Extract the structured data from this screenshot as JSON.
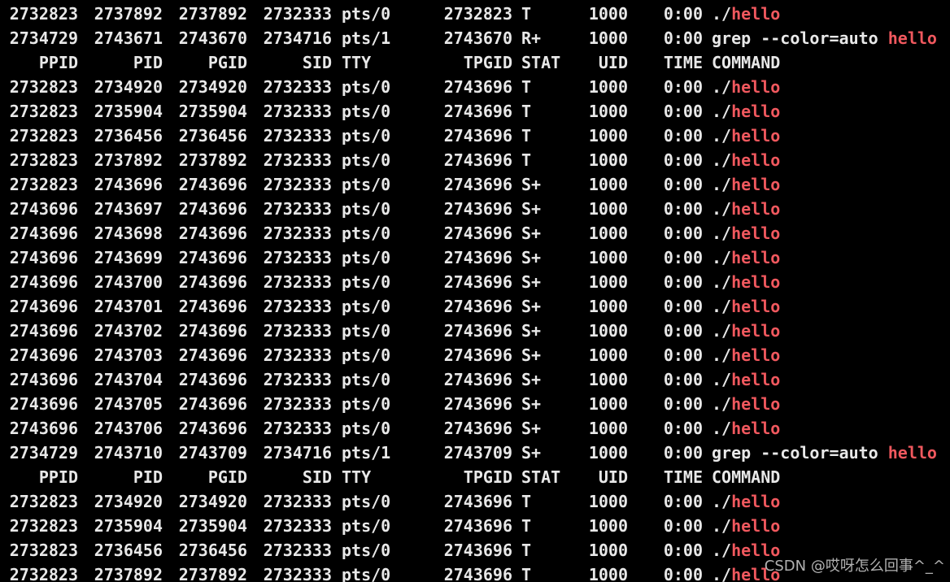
{
  "theme": {
    "background": "#000000",
    "foreground": "#e8e8e8",
    "highlight": "#f0585e"
  },
  "header": {
    "ppid": "PPID",
    "pid": "PID",
    "pgid": "PGID",
    "sid": "SID",
    "tty": "TTY",
    "tpgid": "TPGID",
    "stat": "STAT",
    "uid": "UID",
    "time": "TIME",
    "command": "COMMAND"
  },
  "lines": [
    {
      "type": "proc",
      "ppid": "2732823",
      "pid": "2737892",
      "pgid": "2737892",
      "sid": "2732333",
      "tty": "pts/0",
      "tpgid": "2732823",
      "stat": "T",
      "uid": "1000",
      "time": "0:00",
      "cmd_prefix": "./",
      "cmd_hl": "hello"
    },
    {
      "type": "proc",
      "ppid": "2734729",
      "pid": "2743671",
      "pgid": "2743670",
      "sid": "2734716",
      "tty": "pts/1",
      "tpgid": "2743670",
      "stat": "R+",
      "uid": "1000",
      "time": "0:00",
      "cmd_prefix": "grep --color=auto ",
      "cmd_hl": "hello"
    },
    {
      "type": "header"
    },
    {
      "type": "proc",
      "ppid": "2732823",
      "pid": "2734920",
      "pgid": "2734920",
      "sid": "2732333",
      "tty": "pts/0",
      "tpgid": "2743696",
      "stat": "T",
      "uid": "1000",
      "time": "0:00",
      "cmd_prefix": "./",
      "cmd_hl": "hello"
    },
    {
      "type": "proc",
      "ppid": "2732823",
      "pid": "2735904",
      "pgid": "2735904",
      "sid": "2732333",
      "tty": "pts/0",
      "tpgid": "2743696",
      "stat": "T",
      "uid": "1000",
      "time": "0:00",
      "cmd_prefix": "./",
      "cmd_hl": "hello"
    },
    {
      "type": "proc",
      "ppid": "2732823",
      "pid": "2736456",
      "pgid": "2736456",
      "sid": "2732333",
      "tty": "pts/0",
      "tpgid": "2743696",
      "stat": "T",
      "uid": "1000",
      "time": "0:00",
      "cmd_prefix": "./",
      "cmd_hl": "hello"
    },
    {
      "type": "proc",
      "ppid": "2732823",
      "pid": "2737892",
      "pgid": "2737892",
      "sid": "2732333",
      "tty": "pts/0",
      "tpgid": "2743696",
      "stat": "T",
      "uid": "1000",
      "time": "0:00",
      "cmd_prefix": "./",
      "cmd_hl": "hello"
    },
    {
      "type": "proc",
      "ppid": "2732823",
      "pid": "2743696",
      "pgid": "2743696",
      "sid": "2732333",
      "tty": "pts/0",
      "tpgid": "2743696",
      "stat": "S+",
      "uid": "1000",
      "time": "0:00",
      "cmd_prefix": "./",
      "cmd_hl": "hello"
    },
    {
      "type": "proc",
      "ppid": "2743696",
      "pid": "2743697",
      "pgid": "2743696",
      "sid": "2732333",
      "tty": "pts/0",
      "tpgid": "2743696",
      "stat": "S+",
      "uid": "1000",
      "time": "0:00",
      "cmd_prefix": "./",
      "cmd_hl": "hello"
    },
    {
      "type": "proc",
      "ppid": "2743696",
      "pid": "2743698",
      "pgid": "2743696",
      "sid": "2732333",
      "tty": "pts/0",
      "tpgid": "2743696",
      "stat": "S+",
      "uid": "1000",
      "time": "0:00",
      "cmd_prefix": "./",
      "cmd_hl": "hello"
    },
    {
      "type": "proc",
      "ppid": "2743696",
      "pid": "2743699",
      "pgid": "2743696",
      "sid": "2732333",
      "tty": "pts/0",
      "tpgid": "2743696",
      "stat": "S+",
      "uid": "1000",
      "time": "0:00",
      "cmd_prefix": "./",
      "cmd_hl": "hello"
    },
    {
      "type": "proc",
      "ppid": "2743696",
      "pid": "2743700",
      "pgid": "2743696",
      "sid": "2732333",
      "tty": "pts/0",
      "tpgid": "2743696",
      "stat": "S+",
      "uid": "1000",
      "time": "0:00",
      "cmd_prefix": "./",
      "cmd_hl": "hello"
    },
    {
      "type": "proc",
      "ppid": "2743696",
      "pid": "2743701",
      "pgid": "2743696",
      "sid": "2732333",
      "tty": "pts/0",
      "tpgid": "2743696",
      "stat": "S+",
      "uid": "1000",
      "time": "0:00",
      "cmd_prefix": "./",
      "cmd_hl": "hello"
    },
    {
      "type": "proc",
      "ppid": "2743696",
      "pid": "2743702",
      "pgid": "2743696",
      "sid": "2732333",
      "tty": "pts/0",
      "tpgid": "2743696",
      "stat": "S+",
      "uid": "1000",
      "time": "0:00",
      "cmd_prefix": "./",
      "cmd_hl": "hello"
    },
    {
      "type": "proc",
      "ppid": "2743696",
      "pid": "2743703",
      "pgid": "2743696",
      "sid": "2732333",
      "tty": "pts/0",
      "tpgid": "2743696",
      "stat": "S+",
      "uid": "1000",
      "time": "0:00",
      "cmd_prefix": "./",
      "cmd_hl": "hello"
    },
    {
      "type": "proc",
      "ppid": "2743696",
      "pid": "2743704",
      "pgid": "2743696",
      "sid": "2732333",
      "tty": "pts/0",
      "tpgid": "2743696",
      "stat": "S+",
      "uid": "1000",
      "time": "0:00",
      "cmd_prefix": "./",
      "cmd_hl": "hello"
    },
    {
      "type": "proc",
      "ppid": "2743696",
      "pid": "2743705",
      "pgid": "2743696",
      "sid": "2732333",
      "tty": "pts/0",
      "tpgid": "2743696",
      "stat": "S+",
      "uid": "1000",
      "time": "0:00",
      "cmd_prefix": "./",
      "cmd_hl": "hello"
    },
    {
      "type": "proc",
      "ppid": "2743696",
      "pid": "2743706",
      "pgid": "2743696",
      "sid": "2732333",
      "tty": "pts/0",
      "tpgid": "2743696",
      "stat": "S+",
      "uid": "1000",
      "time": "0:00",
      "cmd_prefix": "./",
      "cmd_hl": "hello"
    },
    {
      "type": "proc",
      "ppid": "2734729",
      "pid": "2743710",
      "pgid": "2743709",
      "sid": "2734716",
      "tty": "pts/1",
      "tpgid": "2743709",
      "stat": "S+",
      "uid": "1000",
      "time": "0:00",
      "cmd_prefix": "grep --color=auto ",
      "cmd_hl": "hello"
    },
    {
      "type": "header"
    },
    {
      "type": "proc",
      "ppid": "2732823",
      "pid": "2734920",
      "pgid": "2734920",
      "sid": "2732333",
      "tty": "pts/0",
      "tpgid": "2743696",
      "stat": "T",
      "uid": "1000",
      "time": "0:00",
      "cmd_prefix": "./",
      "cmd_hl": "hello"
    },
    {
      "type": "proc",
      "ppid": "2732823",
      "pid": "2735904",
      "pgid": "2735904",
      "sid": "2732333",
      "tty": "pts/0",
      "tpgid": "2743696",
      "stat": "T",
      "uid": "1000",
      "time": "0:00",
      "cmd_prefix": "./",
      "cmd_hl": "hello"
    },
    {
      "type": "proc",
      "ppid": "2732823",
      "pid": "2736456",
      "pgid": "2736456",
      "sid": "2732333",
      "tty": "pts/0",
      "tpgid": "2743696",
      "stat": "T",
      "uid": "1000",
      "time": "0:00",
      "cmd_prefix": "./",
      "cmd_hl": "hello"
    },
    {
      "type": "proc",
      "ppid": "2732823",
      "pid": "2737892",
      "pgid": "2737892",
      "sid": "2732333",
      "tty": "pts/0",
      "tpgid": "2743696",
      "stat": "T",
      "uid": "1000",
      "time": "0:00",
      "cmd_prefix": "./",
      "cmd_hl": "hello"
    }
  ],
  "watermark": "CSDN @哎呀怎么回事^_^"
}
